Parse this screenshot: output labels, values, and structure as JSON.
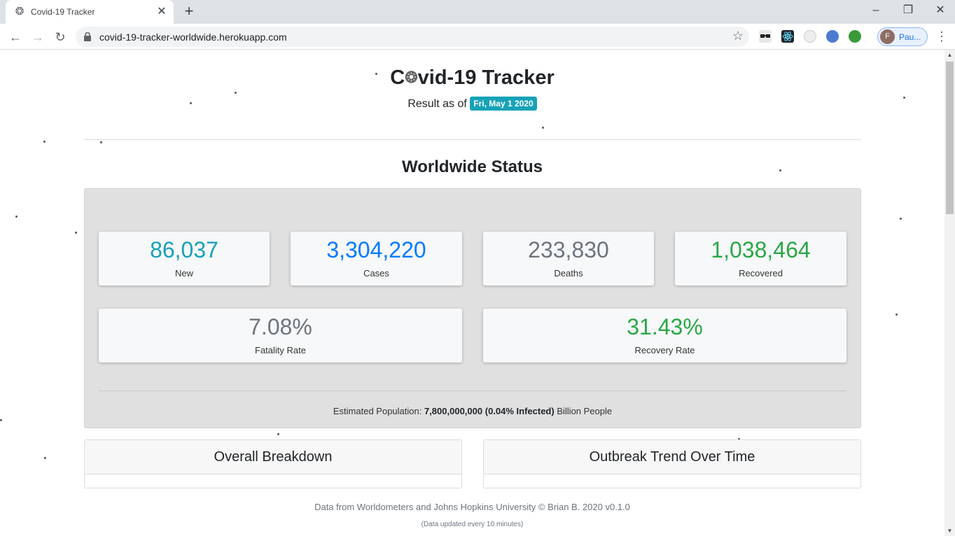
{
  "browser": {
    "tab_title": "Covid-19 Tracker",
    "url": "covid-19-tracker-worldwide.herokuapp.com",
    "profile_initial": "F",
    "profile_name": "Pau..."
  },
  "header": {
    "title_prefix": "C",
    "title_icon": "virus-icon",
    "title_suffix": "vid-19 Tracker",
    "result_label": "Result as of",
    "date": "Fri, May 1 2020"
  },
  "worldwide": {
    "title": "Worldwide Status",
    "stats": {
      "new": {
        "value": "86,037",
        "label": "New",
        "color": "#17a2b8"
      },
      "cases": {
        "value": "3,304,220",
        "label": "Cases",
        "color": "#007bff"
      },
      "deaths": {
        "value": "233,830",
        "label": "Deaths",
        "color": "#6c757d"
      },
      "recovered": {
        "value": "1,038,464",
        "label": "Recovered",
        "color": "#28a745"
      },
      "fatality": {
        "value": "7.08%",
        "label": "Fatality Rate",
        "color": "#6c757d"
      },
      "recovery": {
        "value": "31.43%",
        "label": "Recovery Rate",
        "color": "#28a745"
      }
    },
    "population": {
      "label": "Estimated Population:",
      "value": "7,800,000,000",
      "infected": "(0.04% Infected)",
      "suffix": "Billion People"
    }
  },
  "sections": {
    "breakdown": "Overall Breakdown",
    "trend": "Outbreak Trend Over Time"
  },
  "footer": {
    "credit": "Data from Worldometers and Johns Hopkins University © Brian B. 2020 v0.1.0",
    "note": "(Data updated every 10 minutes)"
  }
}
